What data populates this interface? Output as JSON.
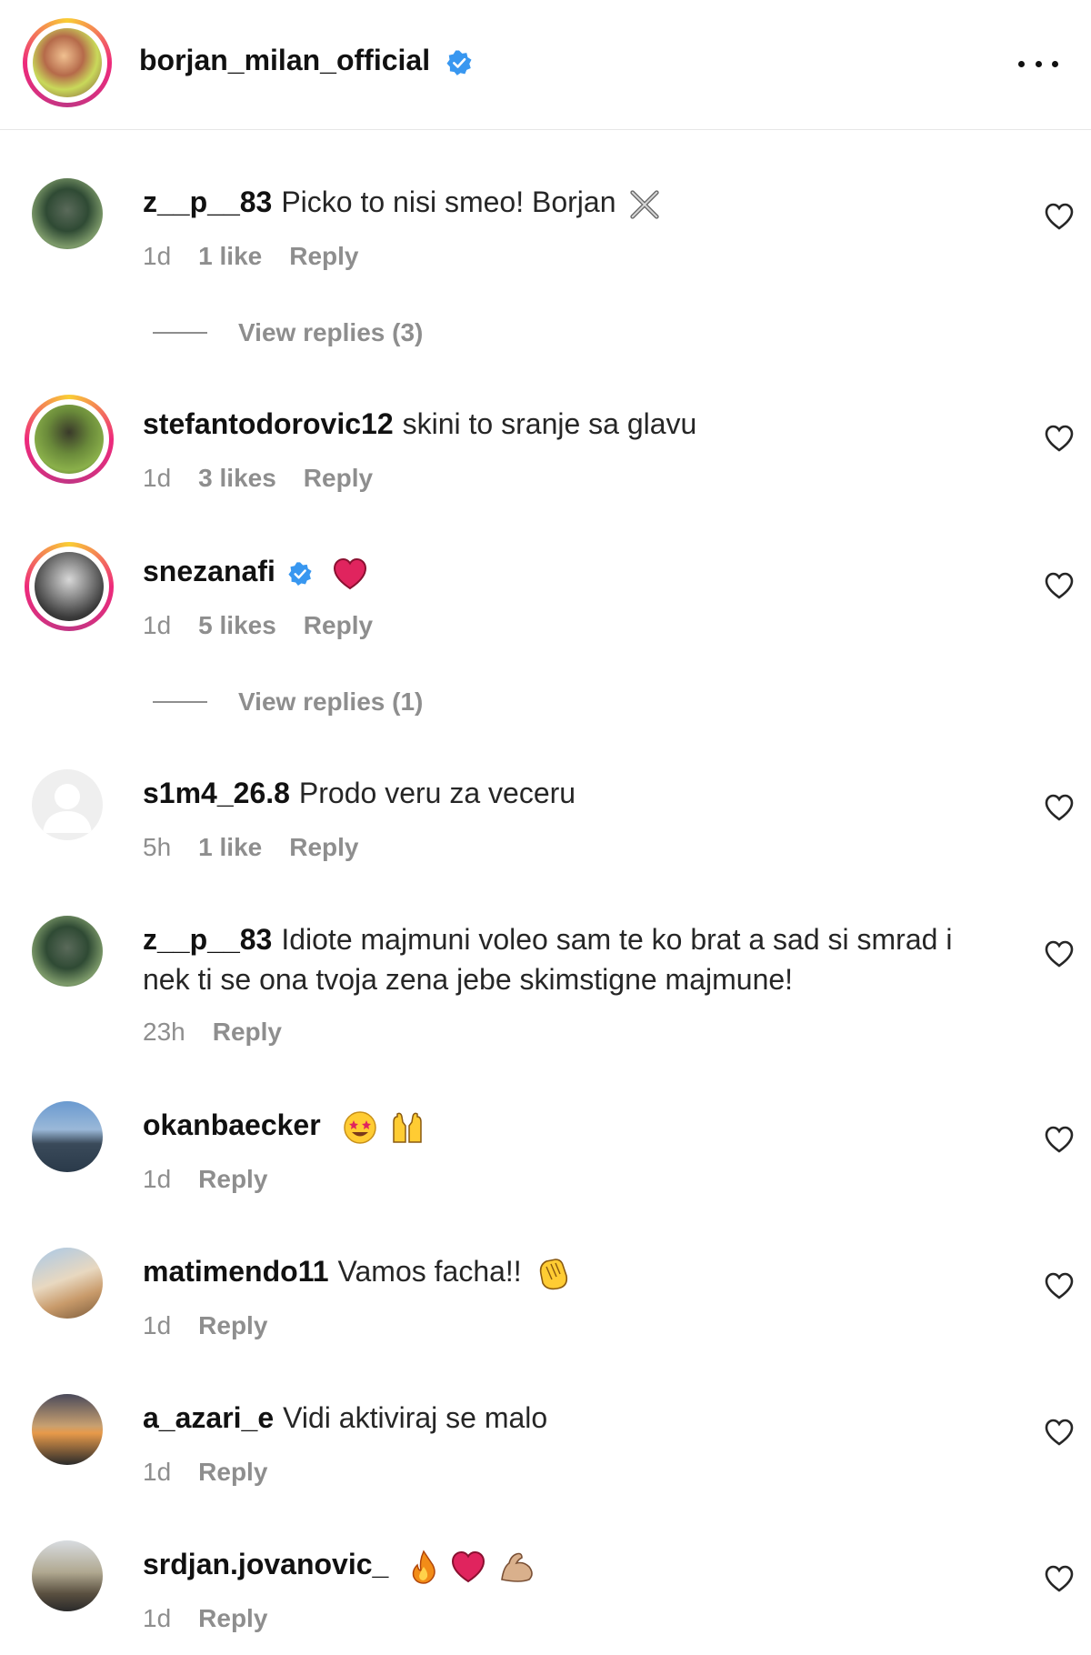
{
  "post": {
    "owner": "borjan_milan_official",
    "verified": true
  },
  "comments": [
    {
      "user": "z__p__83",
      "text": "Picko to nisi smeo! Borjan",
      "emojis": [
        "crossed-swords"
      ],
      "time": "1d",
      "likes": "1 like",
      "reply": "Reply",
      "view_replies": "View replies (3)"
    },
    {
      "user": "stefantodorovic12",
      "text": "skini to sranje sa glavu",
      "emojis": [],
      "time": "1d",
      "likes": "3 likes",
      "reply": "Reply"
    },
    {
      "user": "snezanafi",
      "text": "",
      "verified": true,
      "emojis": [
        "red-heart"
      ],
      "time": "1d",
      "likes": "5 likes",
      "reply": "Reply",
      "view_replies": "View replies (1)"
    },
    {
      "user": "s1m4_26.8",
      "text": "Prodo veru za veceru",
      "emojis": [],
      "time": "5h",
      "likes": "1 like",
      "reply": "Reply"
    },
    {
      "user": "z__p__83",
      "text": "Idiote majmuni voleo sam te ko brat a sad si smrad i nek ti se ona tvoja zena jebe skimstigne majmune!",
      "emojis": [],
      "time": "23h",
      "reply": "Reply"
    },
    {
      "user": "okanbaecker",
      "text": "",
      "emojis": [
        "star-struck",
        "raised-hands"
      ],
      "time": "1d",
      "reply": "Reply"
    },
    {
      "user": "matimendo11",
      "text": "Vamos facha!!",
      "emojis": [
        "clapping-hands"
      ],
      "time": "1d",
      "reply": "Reply"
    },
    {
      "user": "a_azari_e",
      "text": "Vidi aktiviraj se malo",
      "emojis": [],
      "time": "1d",
      "reply": "Reply"
    },
    {
      "user": "srdjan.jovanovic_",
      "text": "",
      "emojis": [
        "fire",
        "red-heart",
        "flexed-biceps"
      ],
      "time": "1d",
      "reply": "Reply"
    }
  ],
  "colors": {
    "verified": "#3897f0",
    "muted_text": "#8e8e8e",
    "heart_emoji": "#e0245e"
  }
}
